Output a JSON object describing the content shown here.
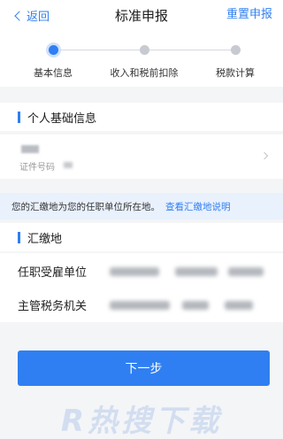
{
  "nav": {
    "back_label": "返回",
    "title": "标准申报",
    "reset_label": "重置申报"
  },
  "steps": [
    {
      "label": "基本信息",
      "active": true
    },
    {
      "label": "收入和税前扣除",
      "active": false
    },
    {
      "label": "税款计算",
      "active": false
    }
  ],
  "personal": {
    "section_title": "个人基础信息",
    "id_label": "证件号码"
  },
  "notice": {
    "text": "您的汇缴地为您的任职单位所在地。",
    "link": "查看汇缴地说明"
  },
  "filing_place": {
    "section_title": "汇缴地",
    "rows": [
      {
        "label": "任职受雇单位"
      },
      {
        "label": "主管税务机关"
      }
    ]
  },
  "next_button": "下一步",
  "watermark": "R热搜下载",
  "colors": {
    "accent": "#2f7ff2",
    "notice_bg": "#e9f1fd",
    "page_bg": "#f4f5f7"
  }
}
